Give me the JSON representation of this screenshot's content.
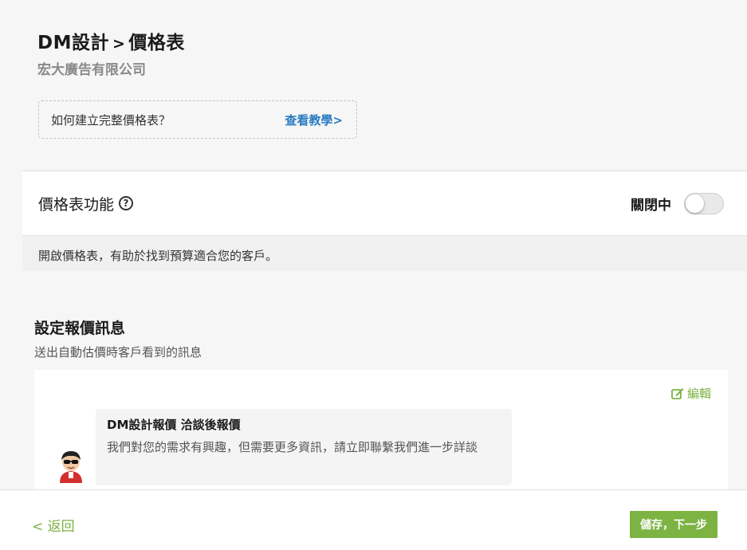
{
  "header": {
    "breadcrumb_parent": "DM設計",
    "breadcrumb_sep": ">",
    "breadcrumb_current": "價格表",
    "company": "宏大廣告有限公司"
  },
  "howto": {
    "question": "如何建立完整價格表？",
    "link_label": "查看教學>"
  },
  "feature": {
    "title": "價格表功能",
    "help_icon": "question-circle-icon",
    "toggle_label": "關閉中",
    "toggle_on": false,
    "description": "開啟價格表，有助於找到預算適合您的客戶。"
  },
  "quote_message": {
    "title": "設定報價訊息",
    "subtitle": "送出自動估價時客戶看到的訊息",
    "edit_label": "編輯",
    "edit_icon": "edit-icon",
    "bubble_title": "DM設計報價 洽談後報價",
    "bubble_body": "我們對您的需求有興趣，但需要更多資訊，請立即聯繫我們進一步詳談"
  },
  "footer": {
    "back_label": "< 返回",
    "next_label": "儲存，下一步"
  },
  "colors": {
    "accent_green": "#7cb342",
    "link_blue": "#2a7cc1"
  }
}
